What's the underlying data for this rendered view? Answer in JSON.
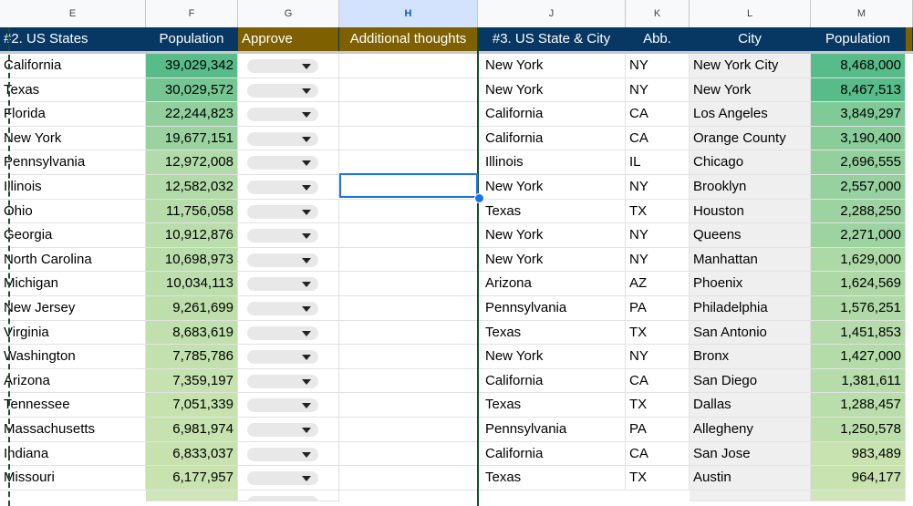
{
  "column_headers": [
    "E",
    "F",
    "G",
    "H",
    "J",
    "K",
    "L",
    "M"
  ],
  "table1": {
    "title": "#2. US States",
    "col_population": "Population",
    "col_approve": "Approve",
    "col_thoughts": "Additional thoughts",
    "rows": [
      {
        "state": "California",
        "population": "39,029,342"
      },
      {
        "state": "Texas",
        "population": "30,029,572"
      },
      {
        "state": "Florida",
        "population": "22,244,823"
      },
      {
        "state": "New York",
        "population": "19,677,151"
      },
      {
        "state": "Pennsylvania",
        "population": "12,972,008"
      },
      {
        "state": "Illinois",
        "population": "12,582,032"
      },
      {
        "state": "Ohio",
        "population": "11,756,058"
      },
      {
        "state": "Georgia",
        "population": "10,912,876"
      },
      {
        "state": "North Carolina",
        "population": "10,698,973"
      },
      {
        "state": "Michigan",
        "population": "10,034,113"
      },
      {
        "state": "New Jersey",
        "population": "9,261,699"
      },
      {
        "state": "Virginia",
        "population": "8,683,619"
      },
      {
        "state": "Washington",
        "population": "7,785,786"
      },
      {
        "state": "Arizona",
        "population": "7,359,197"
      },
      {
        "state": "Tennessee",
        "population": "7,051,339"
      },
      {
        "state": "Massachusetts",
        "population": "6,981,974"
      },
      {
        "state": "Indiana",
        "population": "6,833,037"
      },
      {
        "state": "Missouri",
        "population": "6,177,957"
      }
    ]
  },
  "table2": {
    "title": "#3. US State & City",
    "col_abb": "Abb.",
    "col_city": "City",
    "col_population": "Population",
    "rows": [
      {
        "state": "New York",
        "abb": "NY",
        "city": "New York City",
        "population": "8,468,000"
      },
      {
        "state": "New York",
        "abb": "NY",
        "city": "New York",
        "population": "8,467,513"
      },
      {
        "state": "California",
        "abb": "CA",
        "city": "Los Angeles",
        "population": "3,849,297"
      },
      {
        "state": "California",
        "abb": "CA",
        "city": "Orange County",
        "population": "3,190,400"
      },
      {
        "state": "Illinois",
        "abb": "IL",
        "city": "Chicago",
        "population": "2,696,555"
      },
      {
        "state": "New York",
        "abb": "NY",
        "city": "Brooklyn",
        "population": "2,557,000"
      },
      {
        "state": "Texas",
        "abb": "TX",
        "city": "Houston",
        "population": "2,288,250"
      },
      {
        "state": "New York",
        "abb": "NY",
        "city": "Queens",
        "population": "2,271,000"
      },
      {
        "state": "New York",
        "abb": "NY",
        "city": "Manhattan",
        "population": "1,629,000"
      },
      {
        "state": "Arizona",
        "abb": "AZ",
        "city": "Phoenix",
        "population": "1,624,569"
      },
      {
        "state": "Pennsylvania",
        "abb": "PA",
        "city": "Philadelphia",
        "population": "1,576,251"
      },
      {
        "state": "Texas",
        "abb": "TX",
        "city": "San Antonio",
        "population": "1,451,853"
      },
      {
        "state": "New York",
        "abb": "NY",
        "city": "Bronx",
        "population": "1,427,000"
      },
      {
        "state": "California",
        "abb": "CA",
        "city": "San Diego",
        "population": "1,381,611"
      },
      {
        "state": "Texas",
        "abb": "TX",
        "city": "Dallas",
        "population": "1,288,457"
      },
      {
        "state": "Pennsylvania",
        "abb": "PA",
        "city": "Allegheny",
        "population": "1,250,578"
      },
      {
        "state": "California",
        "abb": "CA",
        "city": "San Jose",
        "population": "983,489"
      },
      {
        "state": "Texas",
        "abb": "TX",
        "city": "Austin",
        "population": "964,177"
      }
    ]
  },
  "colors": {
    "header_bg": "#073763",
    "approve_header_bg": "#7f6000",
    "selection": "#1a73e8",
    "scale_high": "#57bb8a",
    "scale_low": "#c9e3b0"
  }
}
